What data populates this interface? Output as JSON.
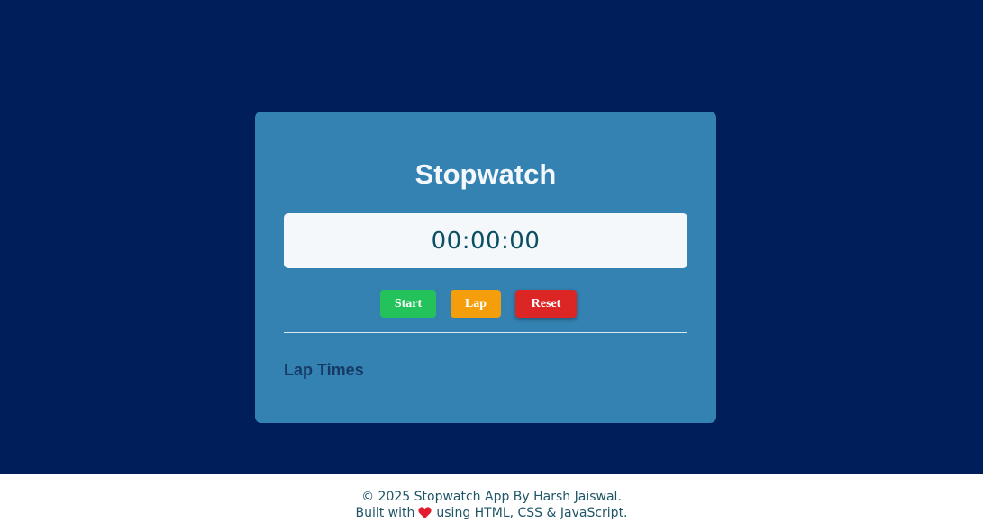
{
  "app": {
    "title": "Stopwatch",
    "time_display": "00:00:00"
  },
  "controls": {
    "start_label": "Start",
    "lap_label": "Lap",
    "reset_label": "Reset"
  },
  "laps": {
    "heading": "Lap Times",
    "items": []
  },
  "footer": {
    "line1": "© 2025 Stopwatch App By Harsh Jaiswal.",
    "line2_prefix": "Built with",
    "line2_suffix": "using HTML, CSS & JavaScript.",
    "icon": "heart-icon"
  },
  "stray_text": "...",
  "colors": {
    "background": "#001e5a",
    "card": "#3382b2",
    "start": "#23c25a",
    "lap": "#f59e0b",
    "reset": "#dc2626",
    "heart": "#e11d2f"
  }
}
